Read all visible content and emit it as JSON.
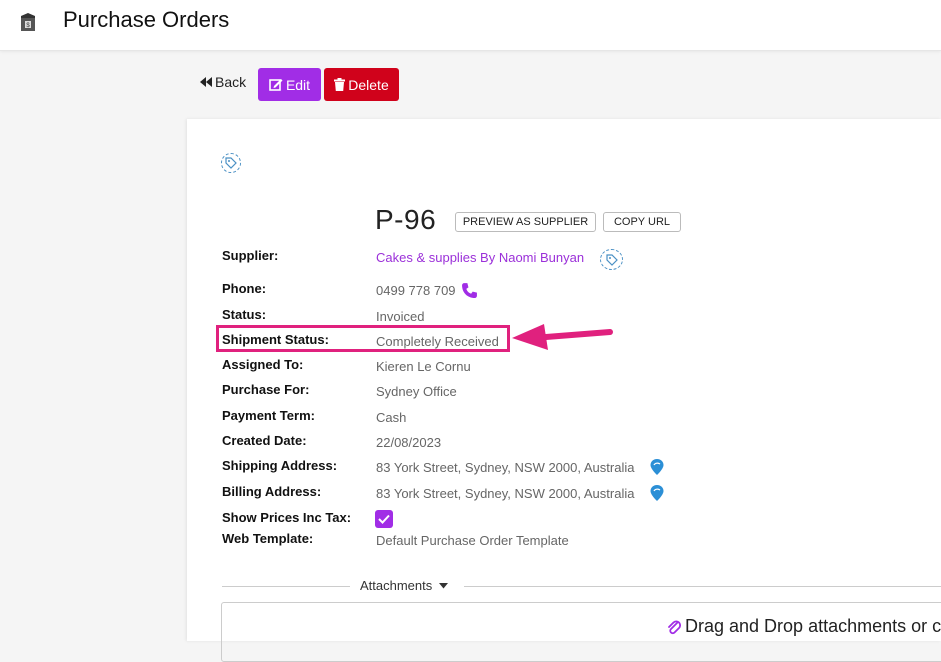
{
  "header": {
    "title": "Purchase Orders",
    "app_icon": "box-dollar-icon"
  },
  "toolbar": {
    "back_label": "Back",
    "edit_label": "Edit",
    "delete_label": "Delete"
  },
  "order": {
    "number": "P-96",
    "preview_label": "PREVIEW AS SUPPLIER",
    "copy_url_label": "COPY URL"
  },
  "fields": {
    "supplier": {
      "label": "Supplier:",
      "value": "Cakes & supplies By Naomi Bunyan"
    },
    "phone": {
      "label": "Phone:",
      "value": "0499 778 709"
    },
    "status": {
      "label": "Status:",
      "value": "Invoiced"
    },
    "shipment_status": {
      "label": "Shipment Status:",
      "value": "Completely Received"
    },
    "assigned_to": {
      "label": "Assigned To:",
      "value": "Kieren Le Cornu"
    },
    "purchase_for": {
      "label": "Purchase For:",
      "value": "Sydney Office"
    },
    "payment_term": {
      "label": "Payment Term:",
      "value": "Cash"
    },
    "created_date": {
      "label": "Created Date:",
      "value": "22/08/2023"
    },
    "shipping_address": {
      "label": "Shipping Address:",
      "value": "83 York Street, Sydney, NSW 2000, Australia"
    },
    "billing_address": {
      "label": "Billing Address:",
      "value": "83 York Street, Sydney, NSW 2000, Australia"
    },
    "show_prices_inc_tax": {
      "label": "Show Prices Inc Tax:",
      "checked": true
    },
    "web_template": {
      "label": "Web Template:",
      "value": "Default Purchase Order Template"
    }
  },
  "attachments": {
    "label": "Attachments",
    "dropzone_text": "Drag and Drop attachments or cli"
  },
  "colors": {
    "accent": "#a12de6",
    "danger": "#d0021b",
    "highlight": "#e0217e",
    "map_pin": "#2b8fd6"
  }
}
